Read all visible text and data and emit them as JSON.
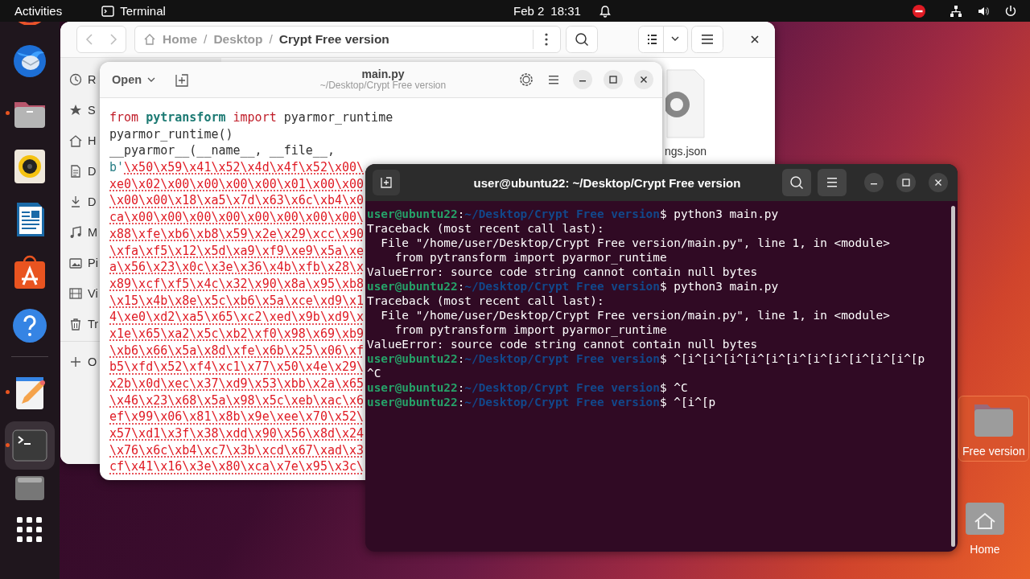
{
  "top_bar": {
    "activities": "Activities",
    "app": "Terminal",
    "date": "Feb 2",
    "time": "18:31"
  },
  "dock": [
    {
      "kind": "browser"
    },
    {
      "kind": "mail",
      "running": false,
      "selected": false
    },
    {
      "kind": "files",
      "running": true,
      "selected": false
    },
    {
      "kind": "music",
      "running": false,
      "selected": false
    },
    {
      "kind": "writer",
      "running": false,
      "selected": false
    },
    {
      "kind": "store",
      "running": false,
      "selected": false
    },
    {
      "kind": "help",
      "running": false,
      "selected": false
    },
    {
      "kind": "separator"
    },
    {
      "kind": "editor",
      "running": true,
      "selected": false
    },
    {
      "kind": "terminal",
      "running": true,
      "selected": true
    },
    {
      "kind": "disk",
      "running": false,
      "selected": false
    },
    {
      "kind": "apps",
      "running": false,
      "selected": false
    }
  ],
  "files_window": {
    "path": [
      {
        "kind": "crumb",
        "text": "Home",
        "selected": false
      },
      {
        "kind": "separator",
        "text": "/"
      },
      {
        "kind": "crumb",
        "text": "Desktop",
        "selected": false
      },
      {
        "kind": "separator",
        "text": "/"
      },
      {
        "kind": "crumb",
        "text": "Crypt Free version",
        "selected": true
      }
    ],
    "sidebar": [
      {
        "kind": "recent",
        "label": "R"
      },
      {
        "kind": "starred",
        "label": "S"
      },
      {
        "kind": "home",
        "label": "H"
      },
      {
        "kind": "documents",
        "label": "D"
      },
      {
        "kind": "downloads",
        "label": "D"
      },
      {
        "kind": "music",
        "label": "M"
      },
      {
        "kind": "pictures",
        "label": "Pi"
      },
      {
        "kind": "videos",
        "label": "Vi"
      },
      {
        "kind": "trash",
        "label": "Tr"
      },
      {
        "kind": "other",
        "label": "O"
      }
    ],
    "files": [
      {
        "label": "ngs.json"
      }
    ]
  },
  "editor_window": {
    "open_button": "Open",
    "title": "main.py",
    "subtitle": "~/Desktop/Crypt Free version",
    "lines": [
      [
        {
          "kind": "keyword",
          "text": "from "
        },
        {
          "kind": "module",
          "text": "pytransform "
        },
        {
          "kind": "keyword",
          "text": "import"
        },
        {
          "kind": "plain",
          "text": " pyarmor_runtime"
        }
      ],
      [
        {
          "kind": "plain",
          "text": "pyarmor_runtime()"
        }
      ],
      [
        {
          "kind": "plain",
          "text": "__pyarmor__(__name__, __file__,"
        }
      ],
      [
        {
          "kind": "prefix",
          "text": "b'"
        },
        {
          "kind": "string",
          "text": "\\x50\\x59\\x41\\x52\\x4d\\x4f\\x52\\x00\\"
        }
      ],
      [
        {
          "kind": "string",
          "text": "xe0\\x02\\x00\\x00\\x00\\x00\\x01\\x00\\x00"
        }
      ],
      [
        {
          "kind": "string",
          "text": "\\x00\\x00\\x18\\xa5\\x7d\\x63\\x6c\\xb4\\x0"
        }
      ],
      [
        {
          "kind": "string",
          "text": "ca\\x00\\x00\\x00\\x00\\x00\\x00\\x00\\x00\\"
        }
      ],
      [
        {
          "kind": "string",
          "text": "x88\\xfe\\xb6\\xb8\\x59\\x2e\\x29\\xcc\\x90"
        }
      ],
      [
        {
          "kind": "string",
          "text": "\\xfa\\xf5\\x12\\x5d\\xa9\\xf9\\xe9\\x5a\\xe"
        }
      ],
      [
        {
          "kind": "string",
          "text": "a\\x56\\x23\\x0c\\x3e\\x36\\x4b\\xfb\\x28\\x"
        }
      ],
      [
        {
          "kind": "string",
          "text": "x89\\xcf\\xf5\\x4c\\x32\\x90\\x8a\\x95\\xb8"
        }
      ],
      [
        {
          "kind": "string",
          "text": "\\x15\\x4b\\x8e\\x5c\\xb6\\x5a\\xce\\xd9\\x1"
        }
      ],
      [
        {
          "kind": "string",
          "text": "4\\xe0\\xd2\\xa5\\x65\\xc2\\xed\\x9b\\xd9\\x"
        }
      ],
      [
        {
          "kind": "string",
          "text": "x1e\\x65\\xa2\\x5c\\xb2\\xf0\\x98\\x69\\xb9"
        }
      ],
      [
        {
          "kind": "string",
          "text": "\\xb6\\x66\\x5a\\x8d\\xfe\\x6b\\x25\\x06\\xf"
        }
      ],
      [
        {
          "kind": "string",
          "text": "b5\\xfd\\x52\\xf4\\xc1\\x77\\x50\\x4e\\x29\\"
        }
      ],
      [
        {
          "kind": "string",
          "text": "x2b\\x0d\\xec\\x37\\xd9\\x53\\xbb\\x2a\\x65"
        }
      ],
      [
        {
          "kind": "string",
          "text": "\\x46\\x23\\x68\\x5a\\x98\\x5c\\xeb\\xac\\x6"
        }
      ],
      [
        {
          "kind": "string",
          "text": "ef\\x99\\x06\\x81\\x8b\\x9e\\xee\\x70\\x52\\"
        }
      ],
      [
        {
          "kind": "string",
          "text": "x57\\xd1\\x3f\\x38\\xdd\\x90\\x56\\x8d\\x24"
        }
      ],
      [
        {
          "kind": "string",
          "text": "\\x76\\x6c\\xb4\\xc7\\x3b\\xcd\\x67\\xad\\x3"
        }
      ],
      [
        {
          "kind": "string",
          "text": "cf\\x41\\x16\\x3e\\x80\\xca\\x7e\\x95\\x3c\\"
        }
      ]
    ]
  },
  "terminal_window": {
    "title": "user@ubuntu22: ~/Desktop/Crypt Free version",
    "lines": [
      [
        {
          "kind": "user",
          "text": "user@ubuntu22"
        },
        {
          "kind": "plain",
          "text": ":"
        },
        {
          "kind": "path",
          "text": "~/Desktop/Crypt Free version"
        },
        {
          "kind": "plain",
          "text": "$ python3 main.py"
        }
      ],
      [
        {
          "kind": "plain",
          "text": "Traceback (most recent call last):"
        }
      ],
      [
        {
          "kind": "plain",
          "text": "  File \"/home/user/Desktop/Crypt Free version/main.py\", line 1, in <module>"
        }
      ],
      [
        {
          "kind": "plain",
          "text": "    from pytransform import pyarmor_runtime"
        }
      ],
      [
        {
          "kind": "plain",
          "text": "ValueError: source code string cannot contain null bytes"
        }
      ],
      [
        {
          "kind": "user",
          "text": "user@ubuntu22"
        },
        {
          "kind": "plain",
          "text": ":"
        },
        {
          "kind": "path",
          "text": "~/Desktop/Crypt Free version"
        },
        {
          "kind": "plain",
          "text": "$ python3 main.py"
        }
      ],
      [
        {
          "kind": "plain",
          "text": "Traceback (most recent call last):"
        }
      ],
      [
        {
          "kind": "plain",
          "text": "  File \"/home/user/Desktop/Crypt Free version/main.py\", line 1, in <module>"
        }
      ],
      [
        {
          "kind": "plain",
          "text": "    from pytransform import pyarmor_runtime"
        }
      ],
      [
        {
          "kind": "plain",
          "text": "ValueError: source code string cannot contain null bytes"
        }
      ],
      [
        {
          "kind": "user",
          "text": "user@ubuntu22"
        },
        {
          "kind": "plain",
          "text": ":"
        },
        {
          "kind": "path",
          "text": "~/Desktop/Crypt Free version"
        },
        {
          "kind": "plain",
          "text": "$ ^[i^[i^[i^[i^[i^[i^[i^[i^[i^[i^[i^[p"
        }
      ],
      [
        {
          "kind": "plain",
          "text": "^C"
        }
      ],
      [
        {
          "kind": "user",
          "text": "user@ubuntu22"
        },
        {
          "kind": "plain",
          "text": ":"
        },
        {
          "kind": "path",
          "text": "~/Desktop/Crypt Free version"
        },
        {
          "kind": "plain",
          "text": "$ ^C"
        }
      ],
      [
        {
          "kind": "user",
          "text": "user@ubuntu22"
        },
        {
          "kind": "plain",
          "text": ":"
        },
        {
          "kind": "path",
          "text": "~/Desktop/Crypt Free version"
        },
        {
          "kind": "plain",
          "text": "$ ^[i^[p"
        }
      ]
    ]
  },
  "desktop_icons": [
    {
      "kind": "folder",
      "label": "Free version",
      "selected": true
    },
    {
      "kind": "home",
      "label": "Home",
      "selected": false
    }
  ]
}
